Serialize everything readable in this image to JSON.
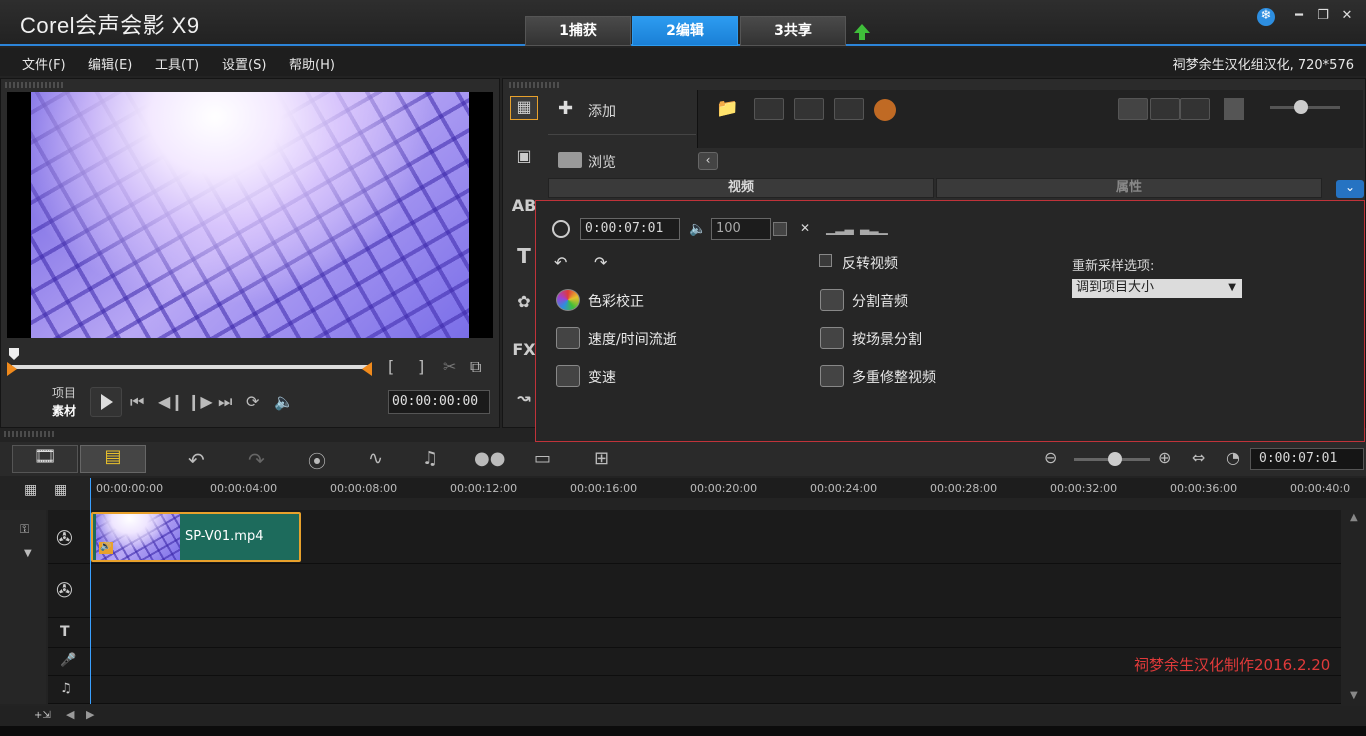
{
  "app": {
    "title": "Corel会声会影 X9"
  },
  "tabs": [
    {
      "label": "1捕获"
    },
    {
      "label": "2编辑"
    },
    {
      "label": "3共享"
    }
  ],
  "menu": {
    "items": [
      {
        "label": "文件(F)"
      },
      {
        "label": "编辑(E)"
      },
      {
        "label": "工具(T)"
      },
      {
        "label": "设置(S)"
      },
      {
        "label": "帮助(H)"
      }
    ],
    "project_info": "祠梦余生汉化组汉化, 720*576"
  },
  "preview": {
    "mode_project": "项目",
    "mode_clip": "素材",
    "timecode": "00:00:00:00"
  },
  "library": {
    "add_label": "添加",
    "browse_label": "浏览",
    "subtabs": [
      {
        "label": "视频"
      },
      {
        "label": "属性"
      }
    ]
  },
  "options": {
    "duration": "0:00:07:01",
    "volume": "100",
    "reverse_video": "反转视频",
    "color_correction": "色彩校正",
    "split_audio": "分割音频",
    "speed_time_lapse": "速度/时间流逝",
    "split_by_scene": "按场景分割",
    "variable_speed": "变速",
    "multi_trim": "多重修整视频",
    "resample_label": "重新采样选项:",
    "resample_value": "调到项目大小"
  },
  "timeline": {
    "duration": "0:00:07:01",
    "ruler": [
      "00:00:00:00",
      "00:00:04:00",
      "00:00:08:00",
      "00:00:12:00",
      "00:00:16:00",
      "00:00:20:00",
      "00:00:24:00",
      "00:00:28:00",
      "00:00:32:00",
      "00:00:36:00",
      "00:00:40:0"
    ],
    "clip_name": "SP-V01.mp4",
    "watermark": "祠梦余生汉化制作2016.2.20"
  },
  "colors": {
    "accent": "#2c84d8",
    "highlight_border": "#c0333a",
    "clip": "#1d6b5c",
    "watermark": "#e03a3a"
  },
  "icons": [
    "folder-icon",
    "video-filter-icon",
    "image-filter-icon",
    "music-filter-icon",
    "flash-icon",
    "play-icon",
    "settings-icon"
  ]
}
